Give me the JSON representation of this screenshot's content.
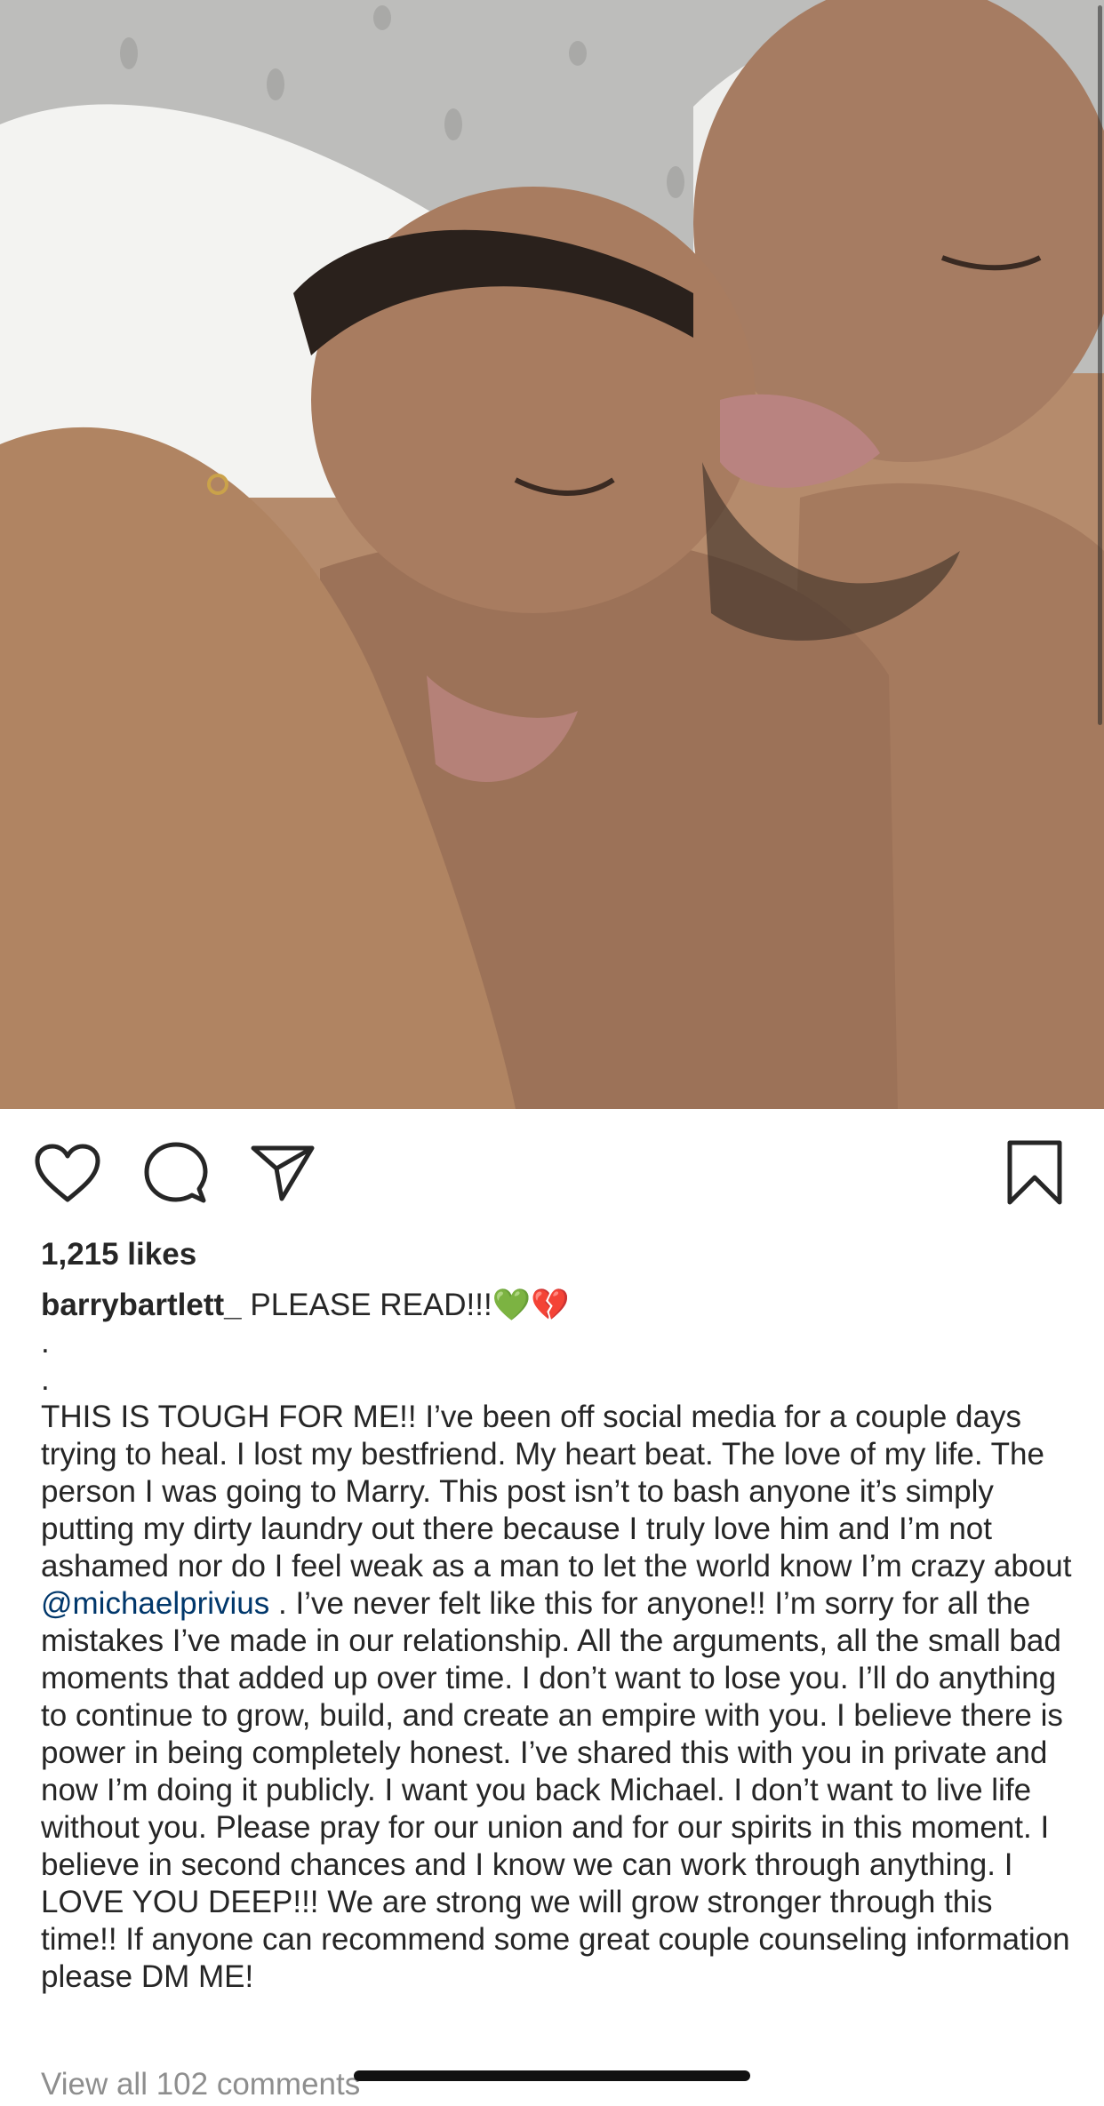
{
  "post": {
    "image_description_icon": "photo-icon",
    "likes_text": "1,215 likes",
    "author": "barrybartlett_",
    "caption_headline": "PLEASE READ!!!",
    "emoji_green_heart": "💚",
    "emoji_broken_heart": "💔",
    "dot_line_1": ".",
    "dot_line_2": ".",
    "caption_part1": "THIS IS TOUGH FOR ME!! I’ve been off social media for a couple days trying to heal. I lost my bestfriend. My heart beat. The love of my life. The person I was going to Marry. This post isn’t to bash anyone it’s simply putting my dirty laundry out there because I truly love him and I’m not ashamed nor do I feel weak as a man to let the world know I’m crazy about ",
    "mention": "@michaelprivius",
    "caption_part2": " . I’ve never felt like this for anyone!! I’m sorry for all the mistakes I’ve made in our relationship. All the arguments, all the small bad moments that added up over time.  I don’t want to lose you. I’ll do anything to continue to grow, build, and create an empire with you. I believe there is power in being completely honest. I’ve shared this with you in private and now I’m doing it publicly. I want you back Michael. I don’t want to live life without you. Please pray for our union and for our spirits in this moment. I believe in second chances and I know we can work through anything. I LOVE YOU DEEP!!! We are strong we will grow stronger through this time!! If anyone can recommend some great couple counseling information please DM ME!",
    "view_comments": "View all 102 comments"
  },
  "actions": {
    "like_icon": "heart-icon",
    "comment_icon": "comment-bubble-icon",
    "share_icon": "paper-plane-icon",
    "save_icon": "bookmark-icon"
  },
  "colors": {
    "text": "#262626",
    "muted": "#8e8e8e",
    "mention": "#00376b"
  }
}
